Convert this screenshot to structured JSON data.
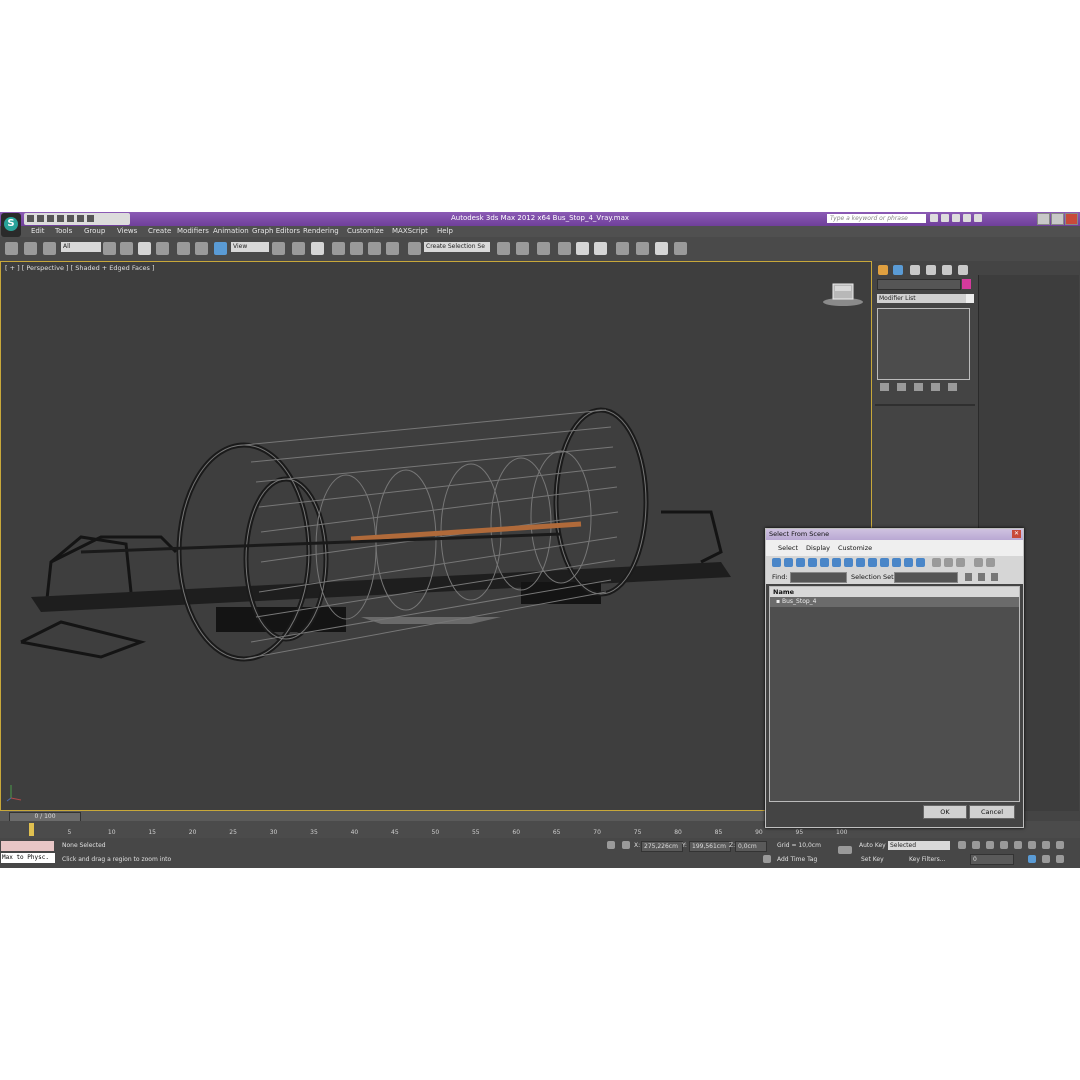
{
  "app": {
    "title": "Autodesk 3ds Max  2012 x64      Bus_Stop_4_Vray.max",
    "search_placeholder": "Type a keyword or phrase"
  },
  "menu": [
    "Edit",
    "Tools",
    "Group",
    "Views",
    "Create",
    "Modifiers",
    "Animation",
    "Graph Editors",
    "Rendering",
    "Customize",
    "MAXScript",
    "Help"
  ],
  "toolbar": {
    "filter_value": "All",
    "refcoord_value": "View",
    "selection_set_value": "Create Selection Se"
  },
  "viewport": {
    "label": "[ + ] [ Perspective ] [ Shaded + Edged Faces ]"
  },
  "command_panel": {
    "modifier_list": "Modifier List",
    "color_swatch": "#d43a9c"
  },
  "timeline": {
    "frame": "0 / 100",
    "ticks": [
      "0",
      "5",
      "10",
      "15",
      "20",
      "25",
      "30",
      "35",
      "40",
      "45",
      "50",
      "55",
      "60",
      "65",
      "70",
      "75",
      "80",
      "85",
      "90",
      "95",
      "100"
    ]
  },
  "status": {
    "max_to_physc": "Max to Physc.",
    "selection": "None Selected",
    "prompt": "Click and drag a region to zoom into",
    "x_label": "X:",
    "x_value": "275,226cm",
    "y_label": "Y:",
    "y_value": "199,561cm",
    "z_label": "Z:",
    "z_value": "0,0cm",
    "grid": "Grid = 10,0cm",
    "add_time_tag": "Add Time Tag",
    "auto_key": "Auto Key",
    "selected": "Selected",
    "set_key": "Set Key",
    "key_filters": "Key Filters...",
    "frame_field": "0"
  },
  "dialog": {
    "title": "Select From Scene",
    "menu": [
      "Select",
      "Display",
      "Customize"
    ],
    "find_label": "Find:",
    "selection_set_label": "Selection Set:",
    "column_name": "Name",
    "rows": [
      "Bus_Stop_4"
    ],
    "ok": "OK",
    "cancel": "Cancel"
  }
}
